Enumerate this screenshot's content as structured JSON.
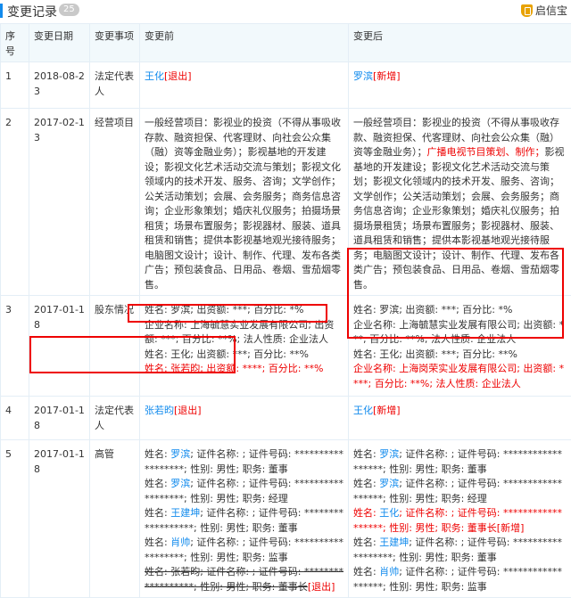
{
  "header": {
    "title": "变更记录",
    "count": "25",
    "brand": "启信宝"
  },
  "columns": [
    "序号",
    "变更日期",
    "变更事项",
    "变更前",
    "变更后"
  ],
  "rows": [
    {
      "no": "1",
      "date": "2018-08-23",
      "item": "法定代表人",
      "before": [
        [
          {
            "t": "王化",
            "c": "blue"
          },
          {
            "t": "[退出]",
            "c": "red"
          }
        ]
      ],
      "after": [
        [
          {
            "t": "罗滨",
            "c": "blue"
          },
          {
            "t": "[新增]",
            "c": "red"
          }
        ]
      ]
    },
    {
      "no": "2",
      "date": "2017-02-13",
      "item": "经营项目",
      "before": [
        [
          {
            "t": "一般经营项目：影视业的投资（不得从事吸收存款、融资担保、代客理财、向社会公众集（融）资等金融业务）；影视基地的开发建设；影视文化艺术活动交流与策划；影视文化领域内的技术开发、服务、咨询；文学创作；公关活动策划；会展、会务服务；商务信息咨询；企业形象策划；婚庆礼仪服务；拍摄场景租赁；场景布置服务；影视器材、服装、道具租赁和销售；提供本影视基地观光接待服务；电脑图文设计；设计、制作、代理、发布各类广告；预包装食品、日用品、卷烟、雪茄烟零售。",
            "c": ""
          }
        ]
      ],
      "after": [
        [
          {
            "t": "一般经营项目：影视业的投资（不得从事吸收存款、融资担保、代客理财、向社会公众集（融）资等金融业务）；",
            "c": ""
          },
          {
            "t": "广播电视节目策划、制作；",
            "c": "red"
          },
          {
            "t": "影视基地的开发建设；影视文化艺术活动交流与策划；影视文化领域内的技术开发、服务、咨询；文学创作；公关活动策划；会展、会务服务；商务信息咨询；企业形象策划；婚庆礼仪服务；拍摄场景租赁；场景布置服务；影视器材、服装、道具租赁和销售；提供本影视基地观光接待服务；电脑图文设计；设计、制作、代理、发布各类广告；预包装食品、日用品、卷烟、雪茄烟零售。",
            "c": ""
          }
        ]
      ]
    },
    {
      "no": "3",
      "date": "2017-01-18",
      "item": "股东情况",
      "before": [
        [
          {
            "t": "姓名: 罗滨; 出资额: ***; 百分比: *%",
            "c": ""
          }
        ],
        [
          {
            "t": "企业名称: 上海毓慧实业发展有限公司; 出资额: ***; 百分比: **%; 法人性质: 企业法人",
            "c": ""
          }
        ],
        [
          {
            "t": "姓名: 王化; 出资额: ***; 百分比: **%",
            "c": ""
          }
        ],
        [
          {
            "t": "姓名: 张若昀; 出资额: ****; 百分比: **%",
            "c": "red"
          }
        ]
      ],
      "after": [
        [
          {
            "t": "姓名: 罗滨; 出资额: ***; 百分比: *%",
            "c": ""
          }
        ],
        [
          {
            "t": "企业名称: 上海毓慧实业发展有限公司; 出资额: ***; 百分比: **%; 法人性质: 企业法人",
            "c": ""
          }
        ],
        [
          {
            "t": "姓名: 王化; 出资额: ***; 百分比: **%",
            "c": ""
          }
        ],
        [
          {
            "t": "企业名称: 上海岗荣实业发展有限公司; 出资额: ****; 百分比: **%; 法人性质: 企业法人",
            "c": "red"
          }
        ]
      ]
    },
    {
      "no": "4",
      "date": "2017-01-18",
      "item": "法定代表人",
      "before": [
        [
          {
            "t": "张若昀",
            "c": "blue"
          },
          {
            "t": "[退出]",
            "c": "red"
          }
        ]
      ],
      "after": [
        [
          {
            "t": "王化",
            "c": "blue"
          },
          {
            "t": "[新增]",
            "c": "red"
          }
        ]
      ]
    },
    {
      "no": "5",
      "date": "2017-01-18",
      "item": "高管",
      "before": [
        [
          {
            "t": "姓名: ",
            "c": ""
          },
          {
            "t": "罗滨",
            "c": "blue"
          },
          {
            "t": "; 证件名称: ; 证件号码: ******************; 性别: 男性; 职务: 董事",
            "c": ""
          }
        ],
        [
          {
            "t": "姓名: ",
            "c": ""
          },
          {
            "t": "罗滨",
            "c": "blue"
          },
          {
            "t": "; 证件名称: ; 证件号码: ******************; 性别: 男性; 职务: 经理",
            "c": ""
          }
        ],
        [
          {
            "t": "姓名: ",
            "c": ""
          },
          {
            "t": "王建坤",
            "c": "blue"
          },
          {
            "t": "; 证件名称: ; 证件号码: ******************; 性别: 男性; 职务: 董事",
            "c": ""
          }
        ],
        [
          {
            "t": "姓名: ",
            "c": ""
          },
          {
            "t": "肖帅",
            "c": "blue"
          },
          {
            "t": "; 证件名称: ; 证件号码: ******************; 性别: 男性; 职务: 监事",
            "c": ""
          }
        ],
        [
          {
            "t": "姓名: 张若昀; 证件名称: ; 证件号码: ******************; 性别: 男性; 职务: 董事长",
            "c": "strike"
          },
          {
            "t": "[退出]",
            "c": "red"
          }
        ]
      ],
      "after": [
        [
          {
            "t": "姓名: ",
            "c": ""
          },
          {
            "t": "罗滨",
            "c": "blue"
          },
          {
            "t": "; 证件名称: ; 证件号码: ******************; 性别: 男性; 职务: 董事",
            "c": ""
          }
        ],
        [
          {
            "t": "姓名: ",
            "c": ""
          },
          {
            "t": "罗滨",
            "c": "blue"
          },
          {
            "t": "; 证件名称: ; 证件号码: ******************; 性别: 男性; 职务: 经理",
            "c": ""
          }
        ],
        [
          {
            "t": "姓名: ",
            "c": "red"
          },
          {
            "t": "王化",
            "c": "blue"
          },
          {
            "t": "; 证件名称: ; 证件号码: ******************; 性别: 男性; 职务: 董事长[新增]",
            "c": "red"
          }
        ],
        [
          {
            "t": "姓名: ",
            "c": ""
          },
          {
            "t": "王建坤",
            "c": "blue"
          },
          {
            "t": "; 证件名称: ; 证件号码: ******************; 性别: 男性; 职务: 董事",
            "c": ""
          }
        ],
        [
          {
            "t": "姓名: ",
            "c": ""
          },
          {
            "t": "肖帅",
            "c": "blue"
          },
          {
            "t": "; 证件名称: ; 证件号码: ******************; 性别: 男性; 职务: 监事",
            "c": ""
          }
        ]
      ]
    }
  ]
}
